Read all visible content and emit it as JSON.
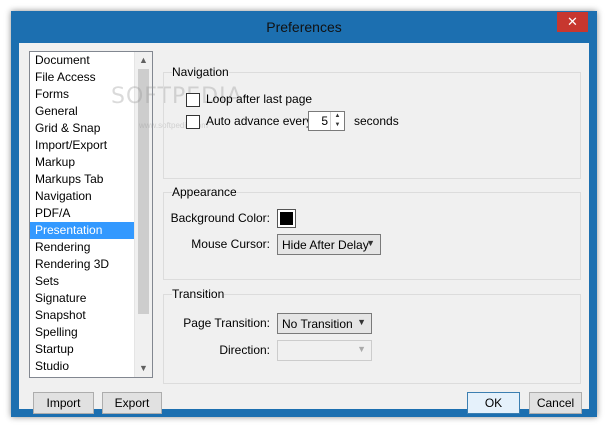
{
  "window": {
    "title": "Preferences",
    "close_glyph": "✕"
  },
  "watermark": {
    "main": "SOFTPEDIA",
    "sub": "www.softpedia.com"
  },
  "categories": {
    "items": [
      "Document",
      "File Access",
      "Forms",
      "General",
      "Grid & Snap",
      "Import/Export",
      "Markup",
      "Markups Tab",
      "Navigation",
      "PDF/A",
      "Presentation",
      "Rendering",
      "Rendering 3D",
      "Sets",
      "Signature",
      "Snapshot",
      "Spelling",
      "Startup",
      "Studio"
    ],
    "selected": "Presentation"
  },
  "navigation": {
    "group_label": "Navigation",
    "loop_label": "Loop after last page",
    "loop_checked": false,
    "auto_label": "Auto advance every",
    "auto_checked": false,
    "auto_value": "5",
    "seconds_label": "seconds"
  },
  "appearance": {
    "group_label": "Appearance",
    "bg_color_label": "Background Color:",
    "bg_color": "#000000",
    "cursor_label": "Mouse Cursor:",
    "cursor_value": "Hide After Delay"
  },
  "transition": {
    "group_label": "Transition",
    "page_transition_label": "Page Transition:",
    "page_transition_value": "No Transition",
    "direction_label": "Direction:",
    "direction_value": ""
  },
  "buttons": {
    "import": "Import",
    "export": "Export",
    "ok": "OK",
    "cancel": "Cancel"
  },
  "colors": {
    "title_bar": "#1c6fb0",
    "close_button": "#c7372f",
    "selection": "#3399ff"
  }
}
